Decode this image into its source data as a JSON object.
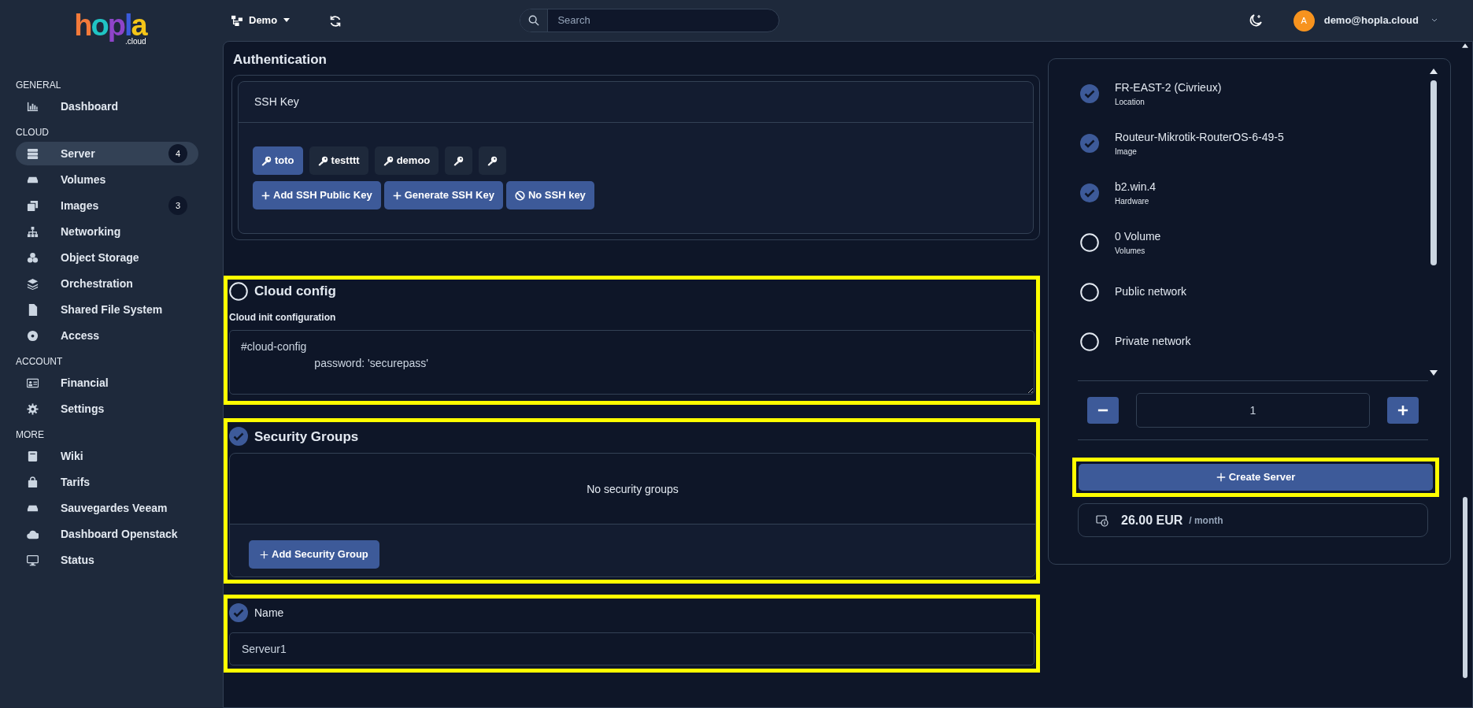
{
  "logo": {
    "letters": [
      {
        "text": "h",
        "color": "#f47a3a"
      },
      {
        "text": "o",
        "color": "#20c4c4"
      },
      {
        "text": "p",
        "color": "#8e44c9"
      },
      {
        "text": "l",
        "color": "#3b5bdb"
      },
      {
        "text": "a",
        "color": "#f5c518"
      }
    ],
    "suffix": ".cloud"
  },
  "sidebar": [
    {
      "heading": "GENERAL",
      "items": [
        {
          "label": "Dashboard",
          "selected": false
        }
      ]
    },
    {
      "heading": "CLOUD",
      "items": [
        {
          "label": "Server",
          "badge": "4",
          "selected": true
        },
        {
          "label": "Volumes",
          "selected": false
        },
        {
          "label": "Images",
          "badge": "3",
          "selected": false
        },
        {
          "label": "Networking",
          "selected": false
        },
        {
          "label": "Object Storage",
          "selected": false
        },
        {
          "label": "Orchestration",
          "selected": false
        },
        {
          "label": "Shared File System",
          "selected": false
        },
        {
          "label": "Access",
          "selected": false
        }
      ]
    },
    {
      "heading": "ACCOUNT",
      "items": [
        {
          "label": "Financial",
          "selected": false
        },
        {
          "label": "Settings",
          "selected": false
        }
      ]
    },
    {
      "heading": "MORE",
      "items": [
        {
          "label": "Wiki",
          "selected": false
        },
        {
          "label": "Tarifs",
          "selected": false
        },
        {
          "label": "Sauvegardes Veeam",
          "selected": false
        },
        {
          "label": "Dashboard Openstack",
          "selected": false
        },
        {
          "label": "Status",
          "selected": false
        }
      ]
    }
  ],
  "topbar": {
    "project": "Demo",
    "search": {
      "placeholder": "Search"
    },
    "avatar": "A",
    "user": "demo@hopla.cloud"
  },
  "authentication": {
    "title": "Authentication",
    "card_title": "SSH Key",
    "keys": [
      {
        "label": "toto",
        "selected": true
      },
      {
        "label": "testttt",
        "selected": false
      },
      {
        "label": "demoo",
        "selected": false
      },
      {
        "selected": false
      },
      {
        "selected": false
      }
    ],
    "actions": [
      {
        "label": "Add SSH Public Key",
        "kind": "add"
      },
      {
        "label": "Generate SSH Key",
        "kind": "add"
      },
      {
        "label": "No SSH key",
        "kind": "none"
      }
    ]
  },
  "cloud_config": {
    "title": "Cloud config",
    "checked": false,
    "highlighted": true,
    "label": "Cloud init configuration",
    "value": "#cloud-config\n                        password: 'securepass'"
  },
  "security_groups": {
    "title": "Security Groups",
    "checked": true,
    "highlighted": true,
    "empty_text": "No security groups",
    "button": "Add Security Group"
  },
  "name": {
    "title": "Name",
    "checked": true,
    "highlighted": true,
    "value": "Serveur1"
  },
  "summary": {
    "steps": [
      {
        "title": "FR-EAST-2 (Civrieux)",
        "subtitle": "Location",
        "done": true
      },
      {
        "title": "Routeur-Mikrotik-RouterOS-6-49-5",
        "subtitle": "Image",
        "done": true
      },
      {
        "title": "b2.win.4",
        "subtitle": "Hardware",
        "done": true
      },
      {
        "title": "0 Volume",
        "subtitle": "Volumes",
        "done": false
      },
      {
        "title": "Public network",
        "done": false
      },
      {
        "title": "Private network",
        "done": false
      }
    ],
    "count": "1",
    "create": {
      "label": "Create Server",
      "highlighted": true
    },
    "price": "26.00 EUR",
    "unit": "/ month"
  }
}
